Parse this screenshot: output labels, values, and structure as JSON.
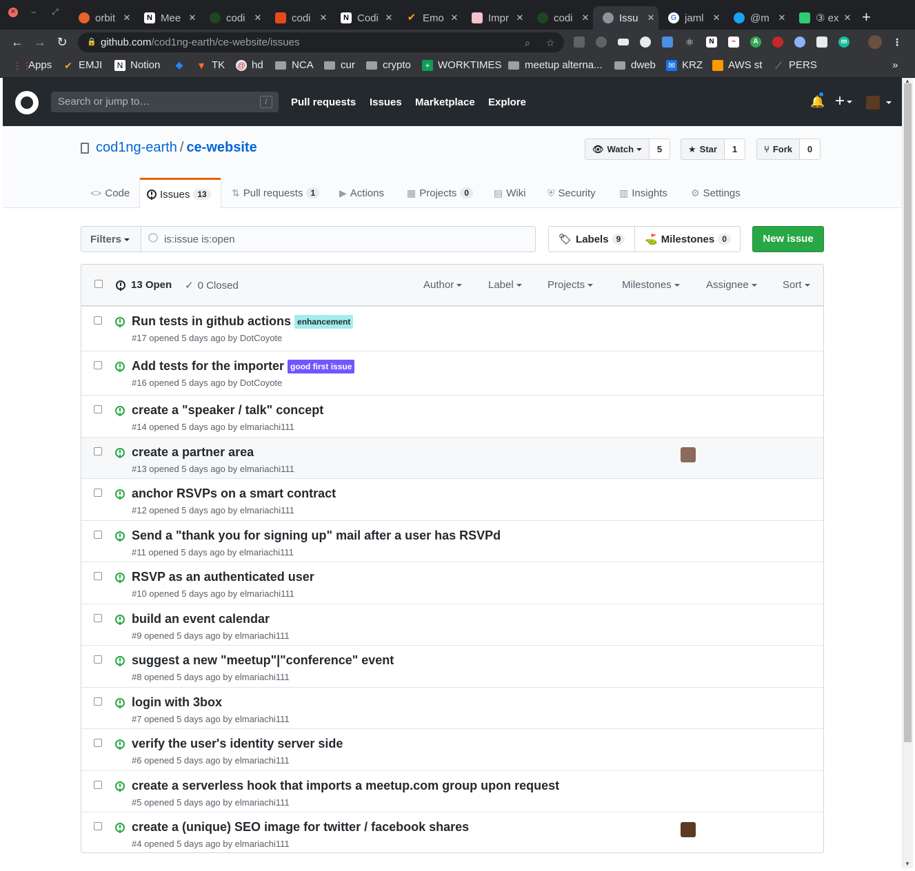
{
  "browser": {
    "tabs": [
      {
        "label": "orbit",
        "color": "#e8622c",
        "icon": "orbit-icon"
      },
      {
        "label": "Mee",
        "color": "#ffffff",
        "icon": "notion-icon"
      },
      {
        "label": "codi",
        "color": "#1e4620",
        "icon": "coding-earth-icon"
      },
      {
        "label": "codi",
        "color": "#e64a19",
        "icon": "document-icon"
      },
      {
        "label": "Codi",
        "color": "#ffffff",
        "icon": "notion-icon"
      },
      {
        "label": "Emo",
        "color": "#f4a02c",
        "icon": "checkmark-icon"
      },
      {
        "label": "Impr",
        "color": "#f6c0cc",
        "icon": "image-icon"
      },
      {
        "label": "codi",
        "color": "#1e4620",
        "icon": "coding-earth-icon"
      },
      {
        "label": "Issu",
        "color": "#8b949e",
        "icon": "github-icon"
      },
      {
        "label": "jaml",
        "color": "#4285f4",
        "icon": "google-icon"
      },
      {
        "label": "@m",
        "color": "#1da1f2",
        "icon": "twitter-icon"
      },
      {
        "label": "③ ex",
        "color": "#2ecc71",
        "icon": "chart-icon"
      }
    ],
    "url_host": "github.com",
    "url_path": "/cod1ng-earth/ce-website/issues",
    "bookmarks": [
      "Apps",
      "EMJI",
      "Notion",
      "",
      "TK",
      "hd",
      "NCA",
      "cur",
      "crypto",
      "WORKTIMES",
      "meetup alterna...",
      "dweb",
      "KRZ",
      "AWS st",
      "PERS"
    ]
  },
  "github": {
    "search_placeholder": "Search or jump to…",
    "search_shortcut": "/",
    "nav": [
      "Pull requests",
      "Issues",
      "Marketplace",
      "Explore"
    ]
  },
  "repo": {
    "owner": "cod1ng-earth",
    "separator": "/",
    "name": "ce-website",
    "watch_label": "Watch",
    "watch_count": "5",
    "star_label": "Star",
    "star_count": "1",
    "fork_label": "Fork",
    "fork_count": "0",
    "tabs": [
      {
        "label": "Code",
        "counter": "",
        "icon": "code-icon"
      },
      {
        "label": "Issues",
        "counter": "13",
        "icon": "issue-icon"
      },
      {
        "label": "Pull requests",
        "counter": "1",
        "icon": "pull-request-icon"
      },
      {
        "label": "Actions",
        "counter": "",
        "icon": "play-icon"
      },
      {
        "label": "Projects",
        "counter": "0",
        "icon": "project-icon"
      },
      {
        "label": "Wiki",
        "counter": "",
        "icon": "book-icon"
      },
      {
        "label": "Security",
        "counter": "",
        "icon": "shield-icon"
      },
      {
        "label": "Insights",
        "counter": "",
        "icon": "graph-icon"
      },
      {
        "label": "Settings",
        "counter": "",
        "icon": "gear-icon"
      }
    ]
  },
  "toolbar": {
    "filters_label": "Filters",
    "query": "is:issue is:open",
    "labels_label": "Labels",
    "labels_count": "9",
    "milestones_label": "Milestones",
    "milestones_count": "0",
    "new_issue_label": "New issue"
  },
  "list_header": {
    "open_label": "13 Open",
    "closed_label": "0 Closed",
    "filters": [
      "Author",
      "Label",
      "Projects",
      "Milestones",
      "Assignee",
      "Sort"
    ]
  },
  "issues": [
    {
      "title": "Run tests in github actions",
      "label": "enhancement",
      "label_bg": "#a2eeef",
      "label_fg": "#24292e",
      "meta": "#17 opened 5 days ago by DotCoyote"
    },
    {
      "title": "Add tests for the importer",
      "label": "good first issue",
      "label_bg": "#7057ff",
      "label_fg": "#ffffff",
      "meta": "#16 opened 5 days ago by DotCoyote"
    },
    {
      "title": "create a \"speaker / talk\" concept",
      "label": "",
      "meta": "#14 opened 5 days ago by elmariachi111"
    },
    {
      "title": "create a partner area",
      "label": "",
      "meta": "#13 opened 5 days ago by elmariachi111"
    },
    {
      "title": "anchor RSVPs on a smart contract",
      "label": "",
      "meta": "#12 opened 5 days ago by elmariachi111"
    },
    {
      "title": "Send a \"thank you for signing up\" mail after a user has RSVPd",
      "label": "",
      "meta": "#11 opened 5 days ago by elmariachi111"
    },
    {
      "title": "RSVP as an authenticated user",
      "label": "",
      "meta": "#10 opened 5 days ago by elmariachi111"
    },
    {
      "title": "build an event calendar",
      "label": "",
      "meta": "#9 opened 5 days ago by elmariachi111"
    },
    {
      "title": "suggest a new \"meetup\"|\"conference\" event",
      "label": "",
      "meta": "#8 opened 5 days ago by elmariachi111"
    },
    {
      "title": "login with 3box",
      "label": "",
      "meta": "#7 opened 5 days ago by elmariachi111"
    },
    {
      "title": "verify the user's identity server side",
      "label": "",
      "meta": "#6 opened 5 days ago by elmariachi111"
    },
    {
      "title": "create a serverless hook that imports a meetup.com group upon request",
      "label": "",
      "meta": "#5 opened 5 days ago by elmariachi111"
    },
    {
      "title": "create a (unique) SEO image for twitter / facebook shares",
      "label": "",
      "meta": "#4 opened 5 days ago by elmariachi111"
    }
  ]
}
